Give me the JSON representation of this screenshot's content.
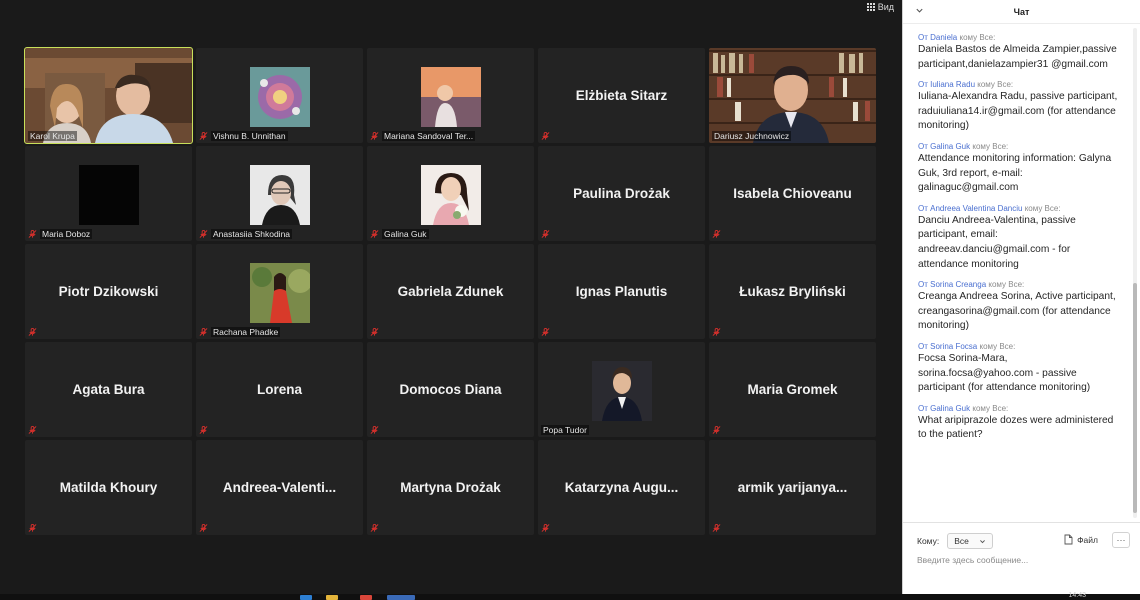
{
  "toolbar": {
    "view_label": "Вид"
  },
  "gallery": {
    "tiles": [
      {
        "name": "Karol Krupa",
        "type": "video",
        "active": true
      },
      {
        "name": "Vishnu B. Unnithan",
        "type": "photo"
      },
      {
        "name": "Mariana Sandoval Ter...",
        "type": "photo"
      },
      {
        "name": "Elżbieta Sitarz",
        "type": "text"
      },
      {
        "name": "Dariusz Juchnowicz",
        "type": "video"
      },
      {
        "name": "Maria Doboz",
        "type": "photo"
      },
      {
        "name": "Anastasiia Shkodina",
        "type": "photo"
      },
      {
        "name": "Galina Guk",
        "type": "photo"
      },
      {
        "name": "Paulina Drożak",
        "type": "text"
      },
      {
        "name": "Isabela Chioveanu",
        "type": "text"
      },
      {
        "name": "Piotr Dzikowski",
        "type": "text"
      },
      {
        "name": "Rachana Phadke",
        "type": "photo"
      },
      {
        "name": "Gabriela Zdunek",
        "type": "text"
      },
      {
        "name": "Ignas Planutis",
        "type": "text"
      },
      {
        "name": "Łukasz Bryliński",
        "type": "text"
      },
      {
        "name": "Agata Bura",
        "type": "text"
      },
      {
        "name": "Lorena",
        "type": "text"
      },
      {
        "name": "Domocos Diana",
        "type": "text"
      },
      {
        "name": "Popa Tudor",
        "type": "photo"
      },
      {
        "name": "Maria Gromek",
        "type": "text"
      },
      {
        "name": "Matilda Khoury",
        "type": "text"
      },
      {
        "name": "Andreea-Valenti...",
        "type": "text"
      },
      {
        "name": "Martyna Drożak",
        "type": "text"
      },
      {
        "name": "Katarzyna Augu...",
        "type": "text"
      },
      {
        "name": "armik yarijanya...",
        "type": "text"
      }
    ]
  },
  "chat": {
    "title": "Чат",
    "messages": [
      {
        "from": "От Daniela",
        "to": "кому Все:",
        "text": "Daniela Bastos de Almeida Zampier,passive participant,danielazampier31 @gmail.com"
      },
      {
        "from": "От Iuliana Radu",
        "to": "кому Все:",
        "text": "Iuliana-Alexandra Radu, passive participant, raduiuliana14.ir@gmail.com (for attendance monitoring)"
      },
      {
        "from": "От Galina Guk",
        "to": "кому Все:",
        "text": "Attendance monitoring information: Galyna Guk, 3rd report, e-mail: galinaguc@gmail.com"
      },
      {
        "from": "От Andreea Valentina Danciu",
        "to": "кому Все:",
        "text": "Danciu Andreea-Valentina, passive participant, email: andreeav.danciu@gmail.com - for attendance monitoring"
      },
      {
        "from": "От Sorina Creanga",
        "to": "кому Все:",
        "text": "Creanga Andreea Sorina, Active participant, creangasorina@gmail.com (for attendance monitoring)"
      },
      {
        "from": "От Sorina Focsa",
        "to": "кому Все:",
        "text": "Focsa Sorina-Mara, sorina.focsa@yahoo.com - passive participant (for attendance monitoring)"
      },
      {
        "from": "От Galina Guk",
        "to": "кому Все:",
        "text": "What aripiprazole dozes were administered to the patient?"
      }
    ],
    "to_label": "Кому:",
    "to_value": "Все",
    "file_label": "Файл",
    "more_label": "···",
    "input_placeholder": "Введите здесь сообщение..."
  },
  "taskbar": {
    "clock": "14:43"
  },
  "colors": {
    "active_outline": "#c8e05a",
    "muted_mic": "#d9302c",
    "chat_sender": "#4a6fd0"
  }
}
